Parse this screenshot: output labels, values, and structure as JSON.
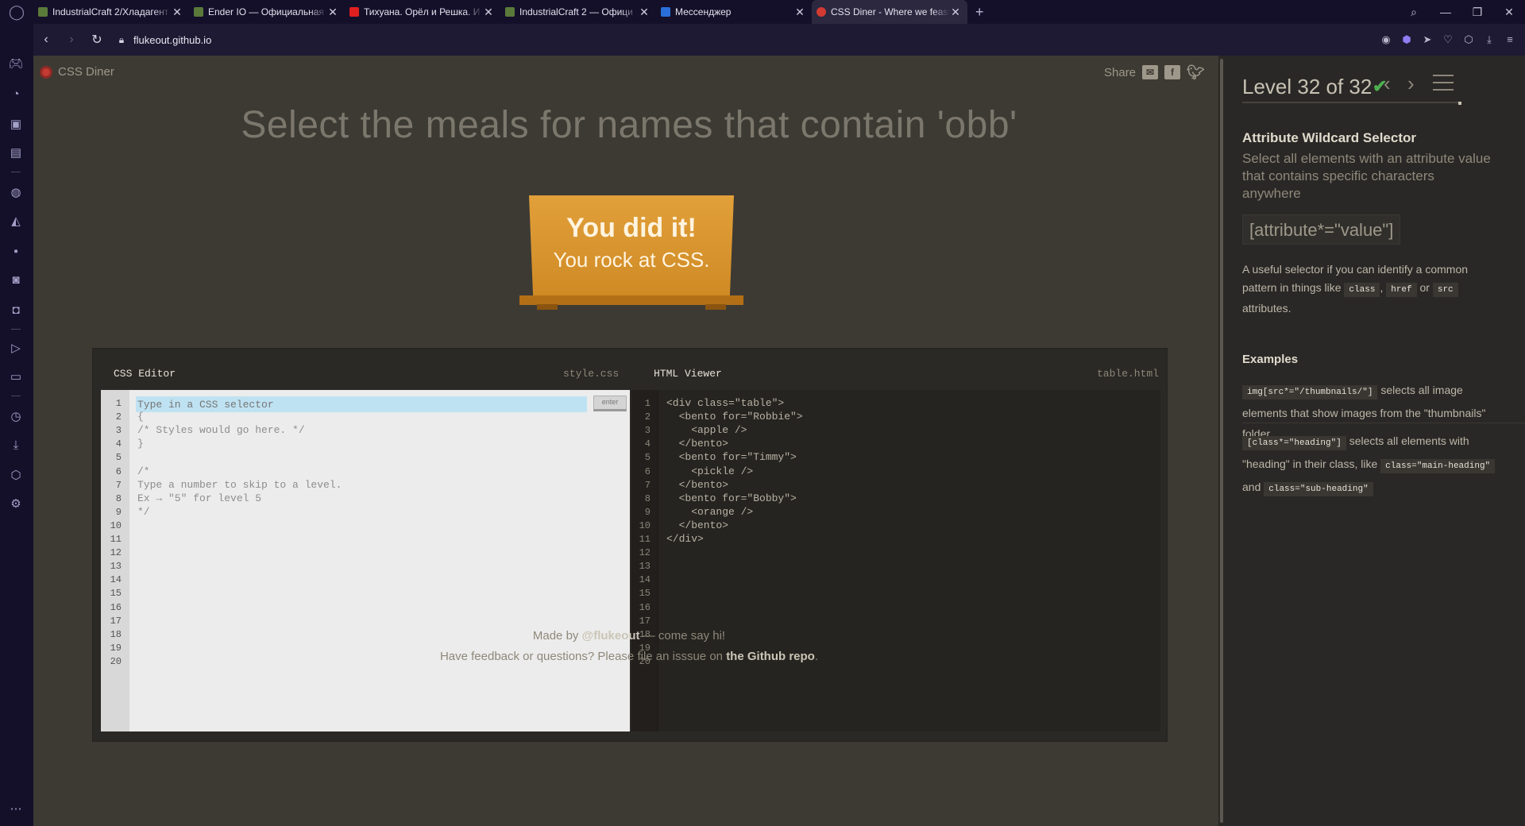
{
  "browser": {
    "tabs": [
      {
        "title": "IndustrialCraft 2/Хладагент",
        "favicon_color": "#5a7a3a"
      },
      {
        "title": "Ender IO — Официальная",
        "favicon_color": "#5a7a3a"
      },
      {
        "title": "Тихуана. Орёл и Решка. И",
        "favicon_color": "#e02020"
      },
      {
        "title": "IndustrialCraft 2 — Офици",
        "favicon_color": "#5a7a3a"
      },
      {
        "title": "Мессенджер",
        "favicon_color": "#2a6fd8"
      },
      {
        "title": "CSS Diner - Where we feast",
        "favicon_color": "#d23a32"
      }
    ],
    "url": "flukeout.github.io"
  },
  "header": {
    "brand": "CSS Diner",
    "share_label": "Share"
  },
  "order": "Select the meals for names that contain 'obb'",
  "success": {
    "line1": "You did it!",
    "line2": "You rock at CSS."
  },
  "css_editor": {
    "title": "CSS Editor",
    "filename": "style.css",
    "placeholder": "Type in a CSS selector",
    "enter_label": "enter",
    "lines": [
      "",
      "{",
      "/* Styles would go here. */",
      "}",
      "",
      "/*",
      "Type a number to skip to a level.",
      "Ex → \"5\" for level 5",
      "*/"
    ],
    "line_numbers": [
      "1",
      "2",
      "3",
      "4",
      "5",
      "6",
      "7",
      "8",
      "9",
      "10",
      "11",
      "12",
      "13",
      "14",
      "15",
      "16",
      "17",
      "18",
      "19",
      "20"
    ]
  },
  "html_viewer": {
    "title": "HTML Viewer",
    "filename": "table.html",
    "lines": [
      "<div class=\"table\">",
      "  <bento for=\"Robbie\">",
      "    <apple />",
      "  </bento>",
      "  <bento for=\"Timmy\">",
      "    <pickle />",
      "  </bento>",
      "  <bento for=\"Bobby\">",
      "    <orange />",
      "  </bento>",
      "</div>"
    ]
  },
  "footer": {
    "made_by_prefix": "Made by",
    "made_by_author": "@flukeout",
    "made_by_suffix": "— come say hi!",
    "feedback_prefix": "Have feedback or questions? Please file an isssue on",
    "feedback_link": "the Github repo",
    "feedback_suffix": "."
  },
  "panel": {
    "level": "Level 32 of 32",
    "selector_name": "Attribute Wildcard Selector",
    "title": "Select all elements with an attribute value that contains specific characters anywhere",
    "syntax": "[attribute*=\"value\"]",
    "hint_prefix": "A useful selector if you can identify a common pattern in things like",
    "hint_kw1": "class",
    "hint_comma": ",",
    "hint_kw2": "href",
    "hint_or": "or",
    "hint_kw3": "src",
    "hint_suffix": "attributes.",
    "examples_heading": "Examples",
    "example1_code": "img[src*=\"/thumbnails/\"]",
    "example1_text": "selects all image elements that show images from the \"thumbnails\" folder.",
    "example2_code": "[class*=\"heading\"]",
    "example2_text": "selects all elements with \"heading\" in their class, like",
    "example2_code2": "class=\"main-heading\"",
    "example2_and": "and",
    "example2_code3": "class=\"sub-heading\""
  },
  "colors": {
    "accent_check": "#4cb050",
    "tray": "#e2a03a",
    "page_bg": "#3d3a34"
  }
}
